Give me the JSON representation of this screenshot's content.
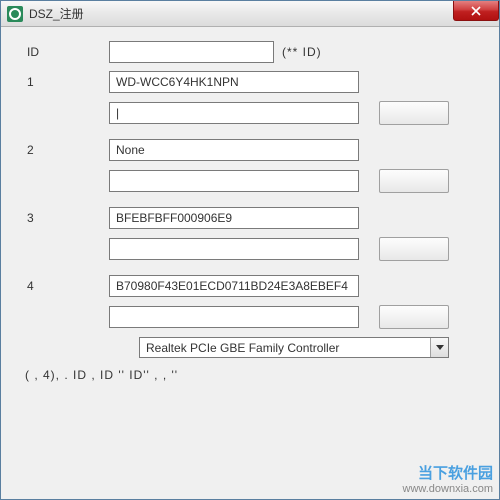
{
  "window": {
    "title": "DSZ_注册"
  },
  "id_row": {
    "label": "ID",
    "value": "",
    "hint": "(**          ID)"
  },
  "sections": [
    {
      "label": "1",
      "main": "WD-WCC6Y4HK1NPN",
      "sub": "|"
    },
    {
      "label": "2",
      "main": "None",
      "sub": ""
    },
    {
      "label": "3",
      "main": "BFEBFBFF000906E9",
      "sub": ""
    },
    {
      "label": "4",
      "main": "B70980F43E01ECD0711BD24E3A8EBEF4",
      "sub": ""
    }
  ],
  "combo": {
    "selected": "Realtek PCIe GBE Family Controller"
  },
  "bottom": "(  ,        4),    .       ID  ,    ID ''     ID''        ,              ,      ''",
  "watermark": {
    "name": "当下软件园",
    "url": "www.downxia.com"
  }
}
